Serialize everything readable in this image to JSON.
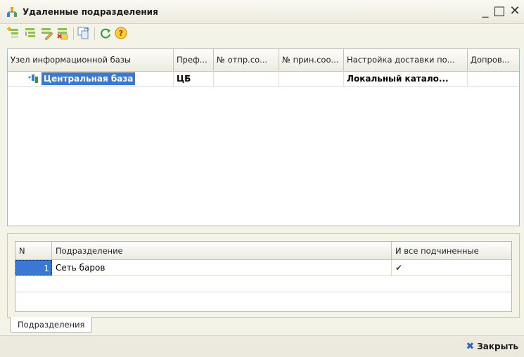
{
  "window": {
    "title": "Удаленные подразделения",
    "minimize": "_",
    "maximize": "□",
    "close": "✕"
  },
  "toolbar": {
    "icons": [
      "add-node-icon",
      "add-child-node-icon",
      "edit-node-icon",
      "delete-node-icon",
      "copy-icon",
      "refresh-icon",
      "help-icon"
    ],
    "help_label": "?"
  },
  "nodes_table": {
    "columns": [
      "Узел информационной базы",
      "Преф...",
      "№ отпр.со...",
      "№ прин.соо...",
      "Настройка доставки по...",
      "Допров..."
    ],
    "rows": [
      {
        "node": "Центральная база",
        "prefix": "ЦБ",
        "sent": "",
        "received": "",
        "delivery": "Локальный катало...",
        "extra": ""
      }
    ]
  },
  "subdivisions_table": {
    "columns": [
      "N",
      "Подразделение",
      "И все подчиненные"
    ],
    "rows": [
      {
        "n": "1",
        "name": "Сеть баров",
        "all_sub": "✔"
      }
    ]
  },
  "tabs": [
    "Подразделения"
  ],
  "footer": {
    "close_label": "Закрыть",
    "close_icon": "✖"
  },
  "colors": {
    "selection": "#3a79d3",
    "background": "#f4f3e8",
    "border": "#a9b7c9"
  }
}
